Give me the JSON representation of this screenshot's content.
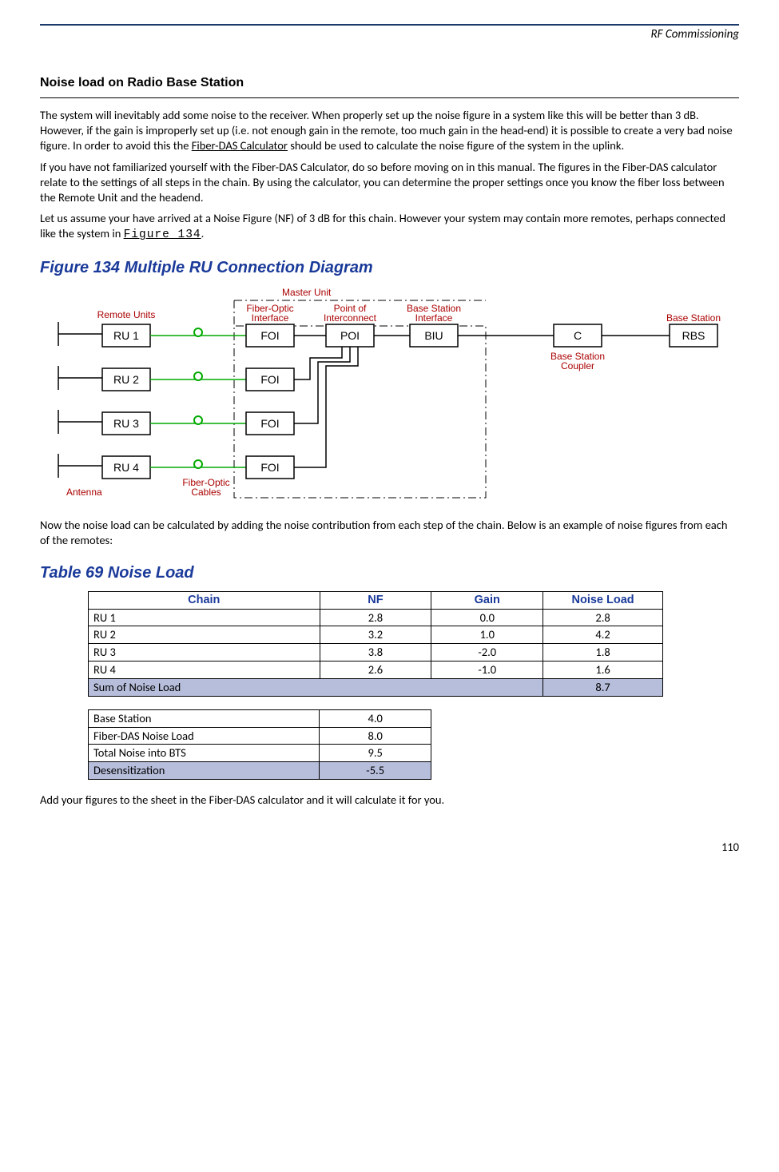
{
  "header": {
    "running": "RF Commissioning"
  },
  "section": {
    "title": "Noise load on Radio Base Station"
  },
  "paras": {
    "p1": "The system will inevitably add some noise to the receiver. When properly set up the noise figure in a system like this will be better than 3 dB. However, if the gain is improperly set up (i.e. not enough gain in the remote, too much gain in the head-end) it is possible to create a very bad noise figure. In order to avoid this the ",
    "p1_link": "Fiber-DAS Calculator",
    "p1b": " should be used to calculate the noise figure of the system in the uplink.",
    "p2": "If you have not familiarized yourself with the Fiber-DAS Calculator, do so before moving on in this manual. The figures in the Fiber-DAS calculator relate to the settings of all steps in the chain. By using the calculator, you can determine the proper settings once you know the fiber loss between the Remote Unit and the headend.",
    "p3a": "Let us assume your have arrived at a Noise Figure (NF) of 3 dB for this chain. However your system may contain more remotes, perhaps connected like the system in ",
    "p3_link": "Figure 134",
    "p3b": ".",
    "p4": "Now the noise load can be calculated by adding the noise contribution from each step of the chain. Below is an example of noise figures from each of the remotes:",
    "p5": "Add your figures to the sheet in the Fiber-DAS calculator and it will calculate it for you."
  },
  "figure": {
    "title": "Figure 134    Multiple RU Connection Diagram",
    "labels": {
      "master": "Master Unit",
      "remote_units": "Remote Units",
      "foi_top": "Fiber-Optic\nInterface",
      "poi_top": "Point of\nInterconnect",
      "biu_top": "Base Station\nInterface",
      "bs_top": "Base Station",
      "coupler": "Base Station\nCoupler",
      "cables": "Fiber-Optic\nCables",
      "antenna": "Antenna",
      "ru1": "RU 1",
      "ru2": "RU 2",
      "ru3": "RU 3",
      "ru4": "RU 4",
      "foi": "FOI",
      "poi": "POI",
      "biu": "BIU",
      "c": "C",
      "rbs": "RBS"
    }
  },
  "table_caption": "Table 69    Noise Load",
  "chart_data": [
    {
      "type": "table",
      "headers": [
        "Chain",
        "NF",
        "Gain",
        "Noise Load"
      ],
      "rows": [
        [
          "RU 1",
          "2.8",
          "0.0",
          "2.8"
        ],
        [
          "RU 2",
          "3.2",
          "1.0",
          "4.2"
        ],
        [
          "RU 3",
          "3.8",
          "-2.0",
          "1.8"
        ],
        [
          "RU 4",
          "2.6",
          "-1.0",
          "1.6"
        ]
      ],
      "summary": [
        "Sum of Noise Load",
        "",
        "",
        "8.7"
      ]
    },
    {
      "type": "table",
      "rows": [
        [
          "Base Station",
          "4.0"
        ],
        [
          "Fiber-DAS Noise Load",
          "8.0"
        ],
        [
          "Total Noise into BTS",
          "9.5"
        ]
      ],
      "summary": [
        "Desensitization",
        "-5.5"
      ]
    }
  ],
  "page_number": "110"
}
